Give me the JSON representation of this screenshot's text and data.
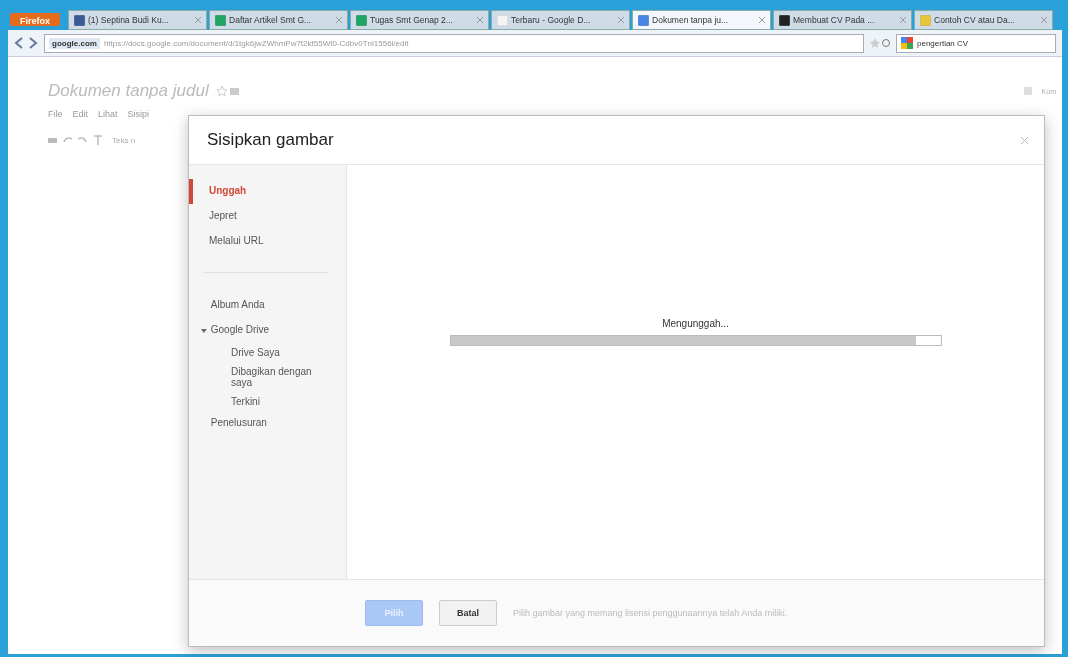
{
  "browser": {
    "menu_button": "Firefox",
    "tabs": [
      {
        "label": "(1) Septina Budi Ku...",
        "kind": "social",
        "selected": false
      },
      {
        "label": "Daftar Artikel Smt G...",
        "kind": "sheet",
        "selected": false
      },
      {
        "label": "Tugas Smt Genap 2...",
        "kind": "sheet",
        "selected": false
      },
      {
        "label": "Terbaru - Google D...",
        "kind": "page",
        "selected": false
      },
      {
        "label": "Dokumen tanpa ju...",
        "kind": "doc",
        "selected": true
      },
      {
        "label": "Membuat CV Pada ...",
        "kind": "dark",
        "selected": false
      },
      {
        "label": "Contoh CV atau Da...",
        "kind": "yellow",
        "selected": false
      }
    ],
    "site": "google.com",
    "url": "https://docs.google.com/document/d/1tgk6jwZWhmPw7t2kt55Wt0-Cdbv0Tnl1556l/edit",
    "search": "pengertian CV"
  },
  "document": {
    "title": "Dokumen tanpa judul",
    "menu": [
      "File",
      "Edit",
      "Lihat",
      "Sisipi"
    ],
    "toolbar_text": "Teks n",
    "right_text": "Kom"
  },
  "dialog": {
    "title": "Sisipkan gambar",
    "nav_top": [
      {
        "label": "Unggah",
        "selected": true
      },
      {
        "label": "Jepret",
        "selected": false
      },
      {
        "label": "Melalui URL",
        "selected": false
      }
    ],
    "nav_bottom": [
      {
        "label": "Album Anda",
        "selected": false
      },
      {
        "label": "Google Drive",
        "selected": false,
        "expanded": true,
        "children": [
          {
            "label": "Drive Saya",
            "selected": false
          },
          {
            "label": "Dibagikan dengan saya",
            "selected": false
          },
          {
            "label": "Terkini",
            "selected": false
          }
        ]
      },
      {
        "label": "Penelusuran",
        "selected": false
      }
    ],
    "status": "Mengunggah...",
    "progress": {
      "level": 0.95
    },
    "buttons": [
      {
        "label": "Pilih",
        "disabled": true
      },
      {
        "label": "Batal",
        "disabled": false
      }
    ],
    "hint": "Pilih gambar yang memang lisensi penggunaannya telah Anda miliki."
  }
}
